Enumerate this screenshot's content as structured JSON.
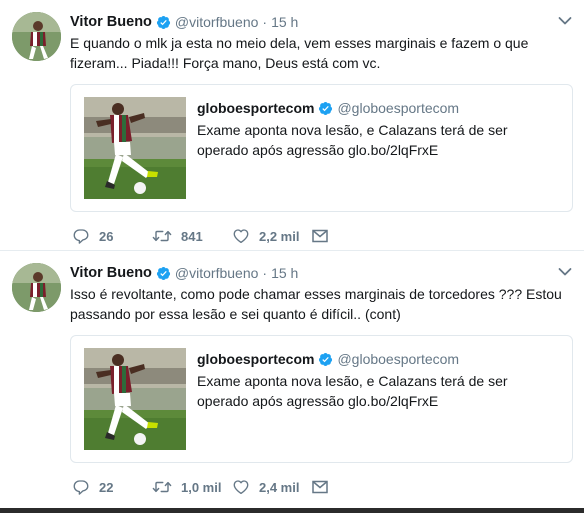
{
  "tweets": [
    {
      "author_name": "Vitor Bueno",
      "author_handle": "@vitorfbueno",
      "separator": "·",
      "time": "15 h",
      "text": "E quando o mlk ja esta no meio dela, vem esses marginais e fazem o que fizeram... Piada!!! Força mano, Deus está com vc.",
      "card": {
        "name": "globoesportecom",
        "handle": "@globoesportecom",
        "text": "Exame aponta nova lesão, e Calazans terá de ser operado após agressão glo.bo/2lqFrxE"
      },
      "replies": "26",
      "retweets": "841",
      "likes": "2,2 mil"
    },
    {
      "author_name": "Vitor Bueno",
      "author_handle": "@vitorfbueno",
      "separator": "·",
      "time": "15 h",
      "text": "Isso é revoltante, como pode chamar esses marginais de torcedores ??? Estou passando por essa lesão e sei quanto é difícil.. (cont)",
      "card": {
        "name": "globoesportecom",
        "handle": "@globoesportecom",
        "text": "Exame aponta nova lesão, e Calazans terá de ser operado após agressão glo.bo/2lqFrxE"
      },
      "replies": "22",
      "retweets": "1,0 mil",
      "likes": "2,4 mil"
    }
  ],
  "icons": {
    "verified": "verified-badge-icon",
    "caret": "chevron-down-icon",
    "reply": "reply-icon",
    "retweet": "retweet-icon",
    "like": "heart-icon",
    "message": "envelope-icon"
  },
  "colors": {
    "verified": "#1da1f2",
    "secondary_text": "#657786",
    "border": "#e1e8ed"
  }
}
